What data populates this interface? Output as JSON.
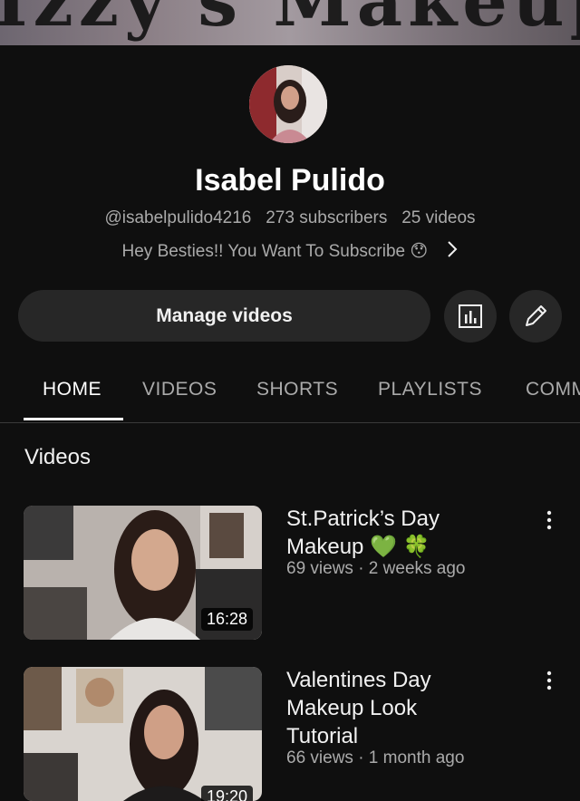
{
  "banner": {
    "text": "Izzy's Makeup"
  },
  "channel": {
    "name": "Isabel Pulido",
    "handle": "@isabelpulido4216",
    "subscribers": "273 subscribers",
    "videos": "25 videos",
    "description": "Hey Besties!! You Want To Subscribe 😯"
  },
  "actions": {
    "manage_label": "Manage videos"
  },
  "tabs": [
    {
      "label": "HOME",
      "active": true
    },
    {
      "label": "VIDEOS"
    },
    {
      "label": "SHORTS"
    },
    {
      "label": "PLAYLISTS"
    },
    {
      "label": "COMMUNITY"
    }
  ],
  "section": {
    "title": "Videos"
  },
  "videos": [
    {
      "title_line1": "St.Patrick’s Day",
      "title_line2": "Makeup 💚 🍀",
      "title_line3": "",
      "meta": "69 views · 2 weeks ago",
      "duration": "16:28"
    },
    {
      "title_line1": "Valentines Day",
      "title_line2": "Makeup Look",
      "title_line3": "Tutorial",
      "meta": "66 views · 1 month ago",
      "duration": "19:20"
    }
  ],
  "colors": {
    "background": "#0f0f0f",
    "button": "#272727",
    "secondary_text": "#aaaaaa"
  }
}
